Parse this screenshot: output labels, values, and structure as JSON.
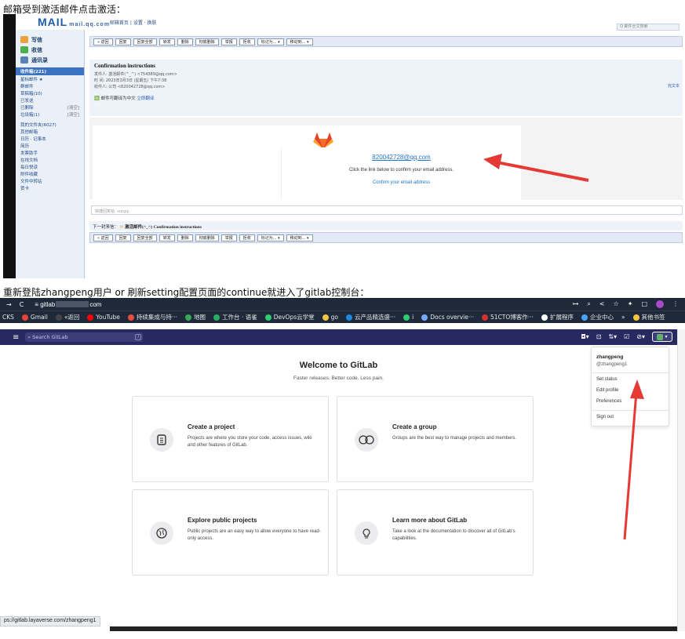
{
  "captions": {
    "top": "邮箱受到激活邮件点击激活：",
    "middle": "重新登陆zhangpeng用户 or 刷新setting配置页面的continue就进入了gitlab控制台："
  },
  "mail": {
    "logo": "MAIL",
    "logo_sub": "mail.qq.com",
    "top_links": "邮箱首页 | 设置 · 换肤",
    "search_placeholder": "Q 邮件全文搜索",
    "compose": "写信",
    "inbox": "收信",
    "contacts": "通讯录",
    "folders": [
      {
        "label": "收件箱(221)",
        "note": ""
      },
      {
        "label": "星标邮件 ★",
        "note": ""
      },
      {
        "label": "群邮件",
        "note": ""
      },
      {
        "label": "草稿箱(10)",
        "note": ""
      },
      {
        "label": "已发送",
        "note": ""
      },
      {
        "label": "已删除",
        "note": "[清空]"
      },
      {
        "label": "垃圾箱(1)",
        "note": "[清空]"
      },
      {
        "label": "我的文件夹(6027)",
        "note": ""
      },
      {
        "label": "其他邮箱",
        "note": ""
      },
      {
        "label": "日历 · 记事本",
        "note": ""
      },
      {
        "label": "简历",
        "note": ""
      },
      {
        "label": "发票助手",
        "note": ""
      },
      {
        "label": "在线文档",
        "note": ""
      },
      {
        "label": "每日悦读",
        "note": ""
      },
      {
        "label": "附件收藏",
        "note": ""
      },
      {
        "label": "文件中转站",
        "note": ""
      },
      {
        "label": "贺卡",
        "note": ""
      }
    ],
    "toolbar": [
      "« 返回",
      "回复",
      "回复全部",
      "转发",
      "删除",
      "彻底删除",
      "举报",
      "拒收",
      "标记为... ▾",
      "移动到... ▾"
    ],
    "subject": "Confirmation instructions",
    "from_line": "发件人: 激活邮件(^_^) <754389@qq.com>",
    "time_line": "时  间: 2023年3月3日 (星期五) 下午7:38",
    "to_line": "收件人: 公司 <820042728@qq.com>",
    "translate": "邮件可翻译为中文",
    "translate_link": "立即翻译",
    "view_full": "完文本",
    "email_address": "820042728@qq.com",
    "instruction": "Click the link below to confirm your email address.",
    "confirm_link": "Confirm your email address",
    "reply_placeholder": "快捷回复给: sunpy",
    "next_label": "下一封来信：",
    "next_from": "激活邮件(^_^)",
    "next_subject": "Confirmation instructions",
    "colors": {
      "accent": "#1f75cb",
      "arrow": "#e53935",
      "fox": "#e24329"
    }
  },
  "gitlab": {
    "url_prefix": "gitlab",
    "url_suffix": "com",
    "bookmarks": [
      {
        "label": "CKS",
        "color": ""
      },
      {
        "label": "Gmail",
        "color": "#ea4335"
      },
      {
        "label": "«返回",
        "color": "#444"
      },
      {
        "label": "YouTube",
        "color": "#ff0000"
      },
      {
        "label": "持续集成与持···",
        "color": "#e74c3c"
      },
      {
        "label": "地图",
        "color": "#34a853"
      },
      {
        "label": "工作台 · 语雀",
        "color": "#27ae60"
      },
      {
        "label": "DevOps云学堂",
        "color": "#2ecc71"
      },
      {
        "label": "go",
        "color": "#f5c542"
      },
      {
        "label": "云产品精选盛···",
        "color": "#1e88e5"
      },
      {
        "label": "i",
        "color": "#2ecc71"
      },
      {
        "label": "Docs overvie···",
        "color": "#7aa9ff"
      },
      {
        "label": "51CTO博客作···",
        "color": "#d32f2f"
      },
      {
        "label": "扩展程序",
        "color": "#fff"
      },
      {
        "label": "企业中心",
        "color": "#4aa3ff"
      },
      {
        "label": "»",
        "color": ""
      },
      {
        "label": "其他书签",
        "color": "#f5c542"
      }
    ],
    "search_placeholder": "Search GitLab",
    "search_hint": "/",
    "welcome_title": "Welcome to GitLab",
    "tagline": "Faster releases. Better code. Less pain.",
    "cards": [
      {
        "title": "Create a project",
        "desc": "Projects are where you store your code, access issues, wiki and other features of GitLab.",
        "icon": "project-icon"
      },
      {
        "title": "Create a group",
        "desc": "Groups are the best way to manage projects and members.",
        "icon": "group-icon"
      },
      {
        "title": "Explore public projects",
        "desc": "Public projects are an easy way to allow everyone to have read-only access.",
        "icon": "globe-icon"
      },
      {
        "title": "Learn more about GitLab",
        "desc": "Take a look at the documentation to discover all of GitLab's capabilities.",
        "icon": "lightbulb-icon"
      }
    ],
    "user_menu": {
      "name": "zhangpeng",
      "handle": "@zhangpeng1",
      "items": [
        "Set status",
        "Edit profile",
        "Preferences",
        "Sign out"
      ]
    },
    "status_url": "ps://gitlab.layaverse.com/zhangpeng1",
    "colors": {
      "navbar": "#292961",
      "chrome": "#1e2a3a",
      "arrow": "#e53935"
    }
  }
}
